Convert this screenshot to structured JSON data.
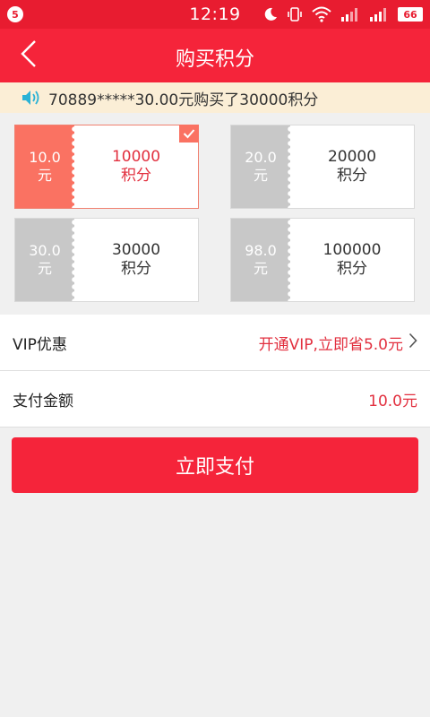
{
  "status_bar": {
    "badge": "5",
    "time": "12:19",
    "battery": "66",
    "icons": [
      "moon-icon",
      "vibrate-icon",
      "wifi-icon",
      "signal-icon",
      "signal-icon",
      "battery-icon"
    ]
  },
  "header": {
    "title": "购买积分",
    "back_icon": "chevron-left-icon"
  },
  "notice": {
    "icon": "speaker-icon",
    "text": "70889*****30.00元购买了30000积分"
  },
  "packages": [
    {
      "price": "10.0",
      "price_unit": "元",
      "points": "10000",
      "points_unit": "积分",
      "selected": true
    },
    {
      "price": "20.0",
      "price_unit": "元",
      "points": "20000",
      "points_unit": "积分",
      "selected": false
    },
    {
      "price": "30.0",
      "price_unit": "元",
      "points": "30000",
      "points_unit": "积分",
      "selected": false
    },
    {
      "price": "98.0",
      "price_unit": "元",
      "points": "100000",
      "points_unit": "积分",
      "selected": false
    }
  ],
  "vip": {
    "label": "VIP优惠",
    "value": "开通VIP,立即省5.0元"
  },
  "payment": {
    "label": "支付金额",
    "amount": "10.0元"
  },
  "pay_button": {
    "label": "立即支付"
  },
  "colors": {
    "brand": "#f5243a",
    "accent": "#e2303f",
    "selected_price": "#fa7262",
    "notice_bg": "#fbeed6"
  }
}
